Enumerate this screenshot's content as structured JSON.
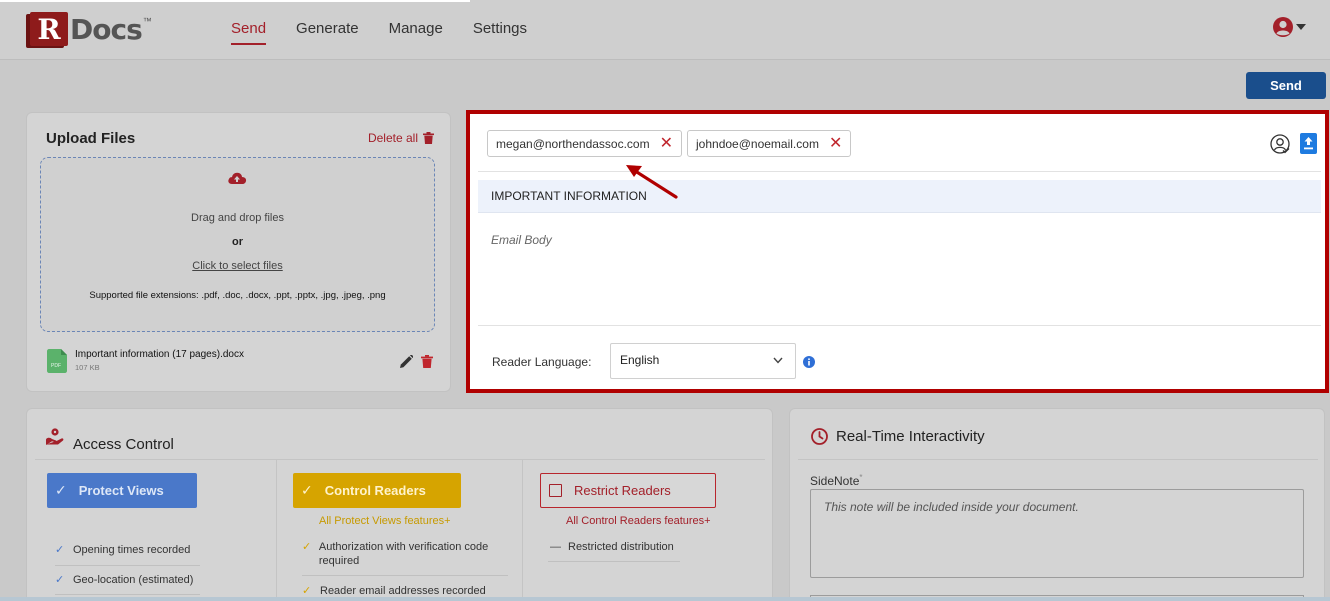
{
  "header": {
    "logo_letter": "R",
    "logo_text": "Docs",
    "logo_tm": "™",
    "nav": [
      "Send",
      "Generate",
      "Manage",
      "Settings"
    ],
    "active_nav": "Send"
  },
  "toolbar": {
    "send_label": "Send"
  },
  "upload": {
    "title": "Upload Files",
    "delete_all": "Delete all",
    "drag_text": "Drag and drop files",
    "or_text": "or",
    "click_text": "Click to select files",
    "extensions_text": "Supported file extensions: .pdf, .doc, .docx, .ppt, .pptx, .jpg, .jpeg, .png",
    "file": {
      "name": "Important information (17 pages).docx",
      "size": "107 KB",
      "icon_label": "PDF"
    }
  },
  "email": {
    "recipients": [
      "megan@northendassoc.com",
      "johndoe@noemail.com"
    ],
    "subject": "IMPORTANT INFORMATION",
    "body_placeholder": "Email Body",
    "reader_language_label": "Reader Language:",
    "reader_language_value": "English"
  },
  "access_control": {
    "title": "Access Control",
    "protect_views": {
      "label": "Protect Views",
      "features": [
        "Opening times recorded",
        "Geo-location (estimated)"
      ]
    },
    "control_readers": {
      "label": "Control Readers",
      "note": "All Protect Views features+",
      "features": [
        "Authorization with verification code required",
        "Reader email addresses recorded"
      ]
    },
    "restrict_readers": {
      "label": "Restrict Readers",
      "note": "All Control Readers features+",
      "features": [
        "Restricted distribution"
      ]
    }
  },
  "realtime": {
    "title": "Real-Time Interactivity",
    "sidenote_label": "SideNote",
    "sidenote_required": "*",
    "sidenote_placeholder": "This note will be included inside your document."
  },
  "colors": {
    "brand_red": "#a3202a",
    "send_blue": "#1a4e8c",
    "highlight_border": "#b00000",
    "protect_blue": "#4a78c9",
    "control_gold": "#d6a400"
  }
}
